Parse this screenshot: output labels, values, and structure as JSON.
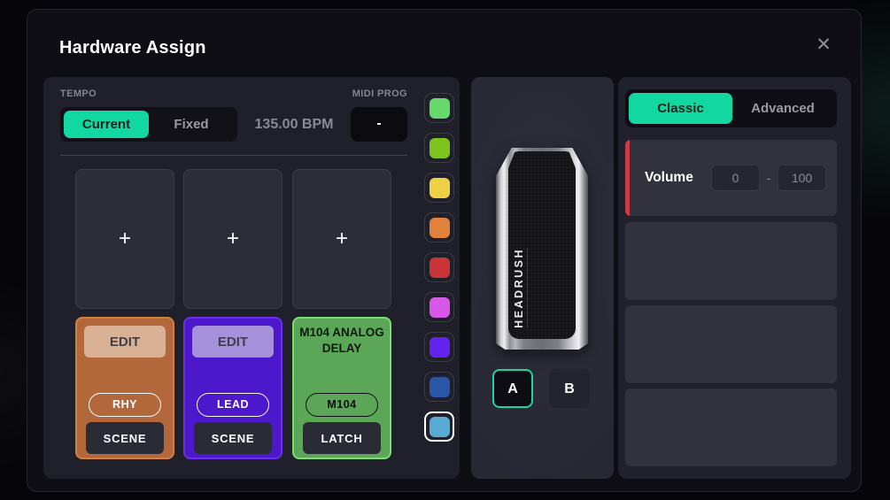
{
  "window": {
    "title": "Hardware Assign",
    "close_icon": "✕"
  },
  "tempo": {
    "label": "TEMPO",
    "mode_current": "Current",
    "mode_fixed": "Fixed",
    "selected_mode": "Current",
    "bpm": "135.00 BPM"
  },
  "midi_prog": {
    "label": "MIDI PROG",
    "value": "-"
  },
  "assign_slots": {
    "add_icon": "+"
  },
  "footswitches": [
    {
      "edit": "EDIT",
      "tag": "RHY",
      "mode": "SCENE",
      "fill": "#b2683a",
      "border": "#d0803f",
      "edit_bg": "#d9b194"
    },
    {
      "edit": "EDIT",
      "tag": "LEAD",
      "mode": "SCENE",
      "fill": "#4d17cc",
      "border": "#6a30e8",
      "edit_bg": "#a491da"
    },
    {
      "title": "M104 ANALOG DELAY",
      "tag": "M104",
      "mode": "LATCH",
      "fill": "#5ba657",
      "border": "#7cdb77"
    }
  ],
  "palette": {
    "colors": [
      "#66d96b",
      "#7fc41e",
      "#edd044",
      "#e0813d",
      "#c93437",
      "#d957e8",
      "#6423ee",
      "#2b55a9",
      "#58abd3"
    ],
    "selected_index": 8
  },
  "pedal": {
    "brand": "HEADRUSH",
    "position_a": "A",
    "position_b": "B",
    "selected_position": "A"
  },
  "curve_tabs": {
    "classic": "Classic",
    "advanced": "Advanced",
    "selected": "Classic"
  },
  "parameters": {
    "rows": [
      {
        "label": "Volume",
        "min": "0",
        "max": "100",
        "separator": "-",
        "accent": "#d03c45"
      }
    ]
  },
  "colors": {
    "accent_teal": "#12d7a0",
    "panel": "#20202a",
    "card": "#32323d",
    "dialog": "#0e0e14"
  }
}
